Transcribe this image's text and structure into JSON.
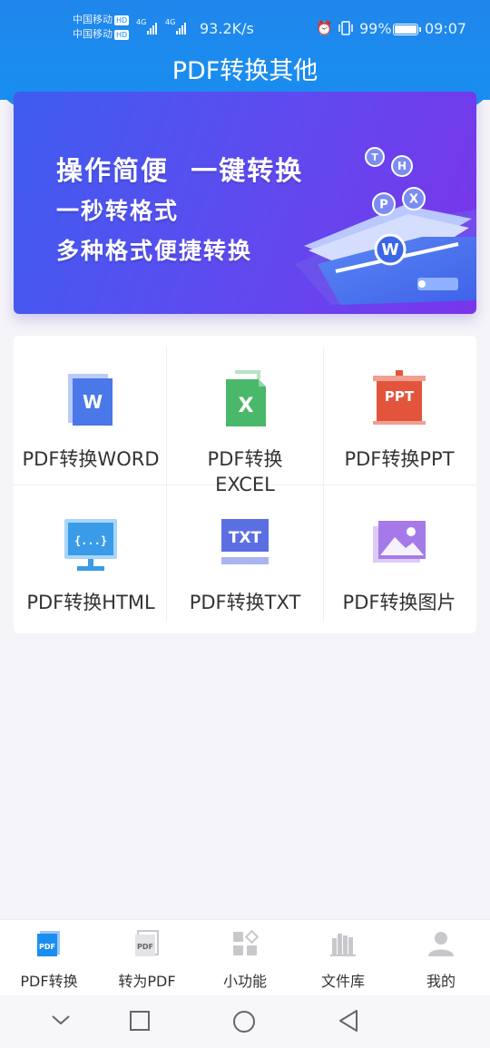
{
  "status_bar": {
    "carrier1": "中国移动",
    "carrier2": "中国移动",
    "hd": "HD",
    "net1": "4G",
    "net2": "4G",
    "speed": "93.2K/s",
    "battery": "99%",
    "time": "09:07"
  },
  "header": {
    "title": "PDF转换其他"
  },
  "banner": {
    "line1": "操作简便  一键转换",
    "line2": "一秒转格式",
    "line3": "多种格式便捷转换",
    "bubbles": [
      "T",
      "H",
      "P",
      "X",
      "W"
    ]
  },
  "tools": [
    {
      "label": "PDF转换WORD",
      "icon": "word-icon",
      "badge": "W",
      "color": "#4a78e8"
    },
    {
      "label": "PDF转换\nEXCEL",
      "icon": "excel-icon",
      "badge": "X",
      "color": "#4ab86a"
    },
    {
      "label": "PDF转换PPT",
      "icon": "ppt-icon",
      "badge": "PPT",
      "color": "#e2553c"
    },
    {
      "label": "PDF转换HTML",
      "icon": "html-icon",
      "badge": "{...}",
      "color": "#3a9be8"
    },
    {
      "label": "PDF转换TXT",
      "icon": "txt-icon",
      "badge": "TXT",
      "color": "#5b6fe3"
    },
    {
      "label": "PDF转换图片",
      "icon": "image-icon",
      "badge": "",
      "color": "#a57ae8"
    }
  ],
  "tabbar": [
    {
      "label": "PDF转换",
      "icon": "pdf-convert-icon",
      "badge": "PDF",
      "active": true
    },
    {
      "label": "转为PDF",
      "icon": "to-pdf-icon",
      "badge": "PDF",
      "active": false
    },
    {
      "label": "小功能",
      "icon": "tools-grid-icon",
      "active": false
    },
    {
      "label": "文件库",
      "icon": "library-icon",
      "active": false
    },
    {
      "label": "我的",
      "icon": "user-icon",
      "active": false
    }
  ],
  "system_nav": [
    "back-chevron-icon",
    "recents-icon",
    "home-icon",
    "back-triangle-icon"
  ],
  "colors": {
    "header": "#1a8ef0",
    "accent": "#1a8ef0",
    "inactive": "#c8c8cc"
  }
}
